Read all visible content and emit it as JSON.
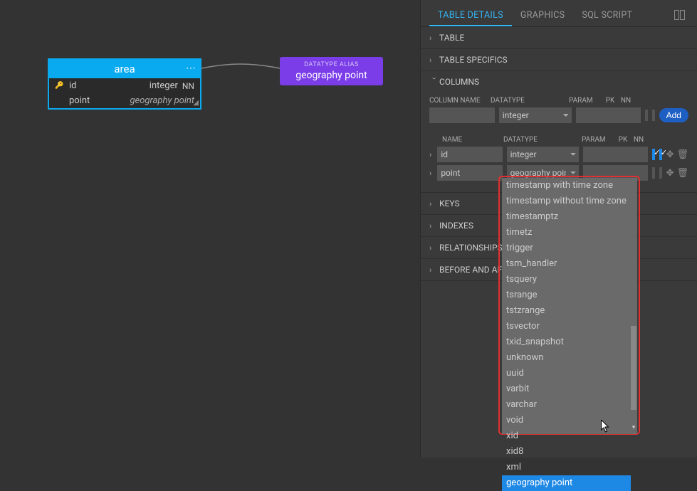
{
  "canvas": {
    "table": {
      "name": "area",
      "columns": [
        {
          "name": "id",
          "type": "integer",
          "nn": "NN",
          "pk": true
        },
        {
          "name": "point",
          "type": "geography point",
          "nn": "",
          "pk": false
        }
      ]
    },
    "alias": {
      "label": "DATATYPE ALIAS",
      "name": "geography point"
    }
  },
  "panel": {
    "tabs": [
      {
        "label": "TABLE DETAILS",
        "active": true
      },
      {
        "label": "GRAPHICS",
        "active": false
      },
      {
        "label": "SQL SCRIPT",
        "active": false
      }
    ],
    "sections": {
      "table": "TABLE",
      "specifics": "TABLE SPECIFICS",
      "columns": "COLUMNS",
      "keys": "KEYS",
      "indexes": "INDEXES",
      "relationships": "RELATIONSHIPS",
      "before_after": "BEFORE AND AFTER SCRIPTS"
    },
    "column_form": {
      "labels": {
        "name": "COLUMN NAME",
        "datatype": "DATATYPE",
        "param": "PARAM",
        "pk": "PK",
        "nn": "NN",
        "name2": "NAME"
      },
      "new_row": {
        "name": "",
        "datatype": "integer",
        "param": ""
      },
      "add_label": "Add",
      "rows": [
        {
          "name": "id",
          "datatype": "integer",
          "param": "",
          "pk": true,
          "nn": true
        },
        {
          "name": "point",
          "datatype": "geography point",
          "param": "",
          "pk": false,
          "nn": false
        }
      ]
    },
    "dropdown": {
      "options": [
        "timestamp with time zone",
        "timestamp without time zone",
        "timestamptz",
        "timetz",
        "trigger",
        "tsm_handler",
        "tsquery",
        "tsrange",
        "tstzrange",
        "tsvector",
        "txid_snapshot",
        "unknown",
        "uuid",
        "varbit",
        "varchar",
        "void",
        "xid",
        "xid8",
        "xml",
        "geography point"
      ],
      "selected": "geography point"
    }
  }
}
